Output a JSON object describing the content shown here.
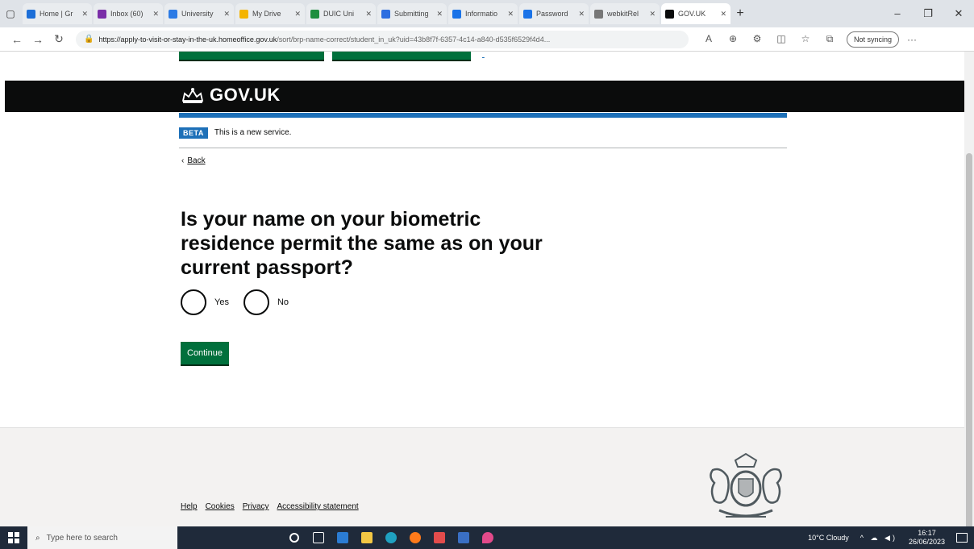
{
  "browser": {
    "tabs": [
      {
        "label": "Home | Gr",
        "color": "#1d6fd8"
      },
      {
        "label": "Inbox (60)",
        "color": "#7a2ea8"
      },
      {
        "label": "University",
        "color": "#2c7be5"
      },
      {
        "label": "My Drive",
        "color": "#f4b400"
      },
      {
        "label": "DUIC Uni",
        "color": "#1e8e3e"
      },
      {
        "label": "Submitting",
        "color": "#2d6ee0"
      },
      {
        "label": "Informatio",
        "color": "#1a73e8"
      },
      {
        "label": "Password",
        "color": "#1a73e8"
      },
      {
        "label": "webkitRel",
        "color": "#777777"
      },
      {
        "label": "GOV.UK",
        "color": "#0b0c0c",
        "active": true
      }
    ],
    "url_host": "https://apply-to-visit-or-stay-in-the-uk.homeoffice.gov.uk",
    "url_path": "/sort/brp-name-correct/student_in_uk?uid=43b8f7f-6357-4c14-a840-d535f6529f4d4...",
    "sync_label": "Not syncing"
  },
  "page": {
    "header_logo": "GOV.UK",
    "phase_tag": "BETA",
    "phase_text": "This is a new service.",
    "back_link": "Back",
    "question": "Is your name on your biometric residence permit the same as on your current passport?",
    "options": [
      "Yes",
      "No"
    ],
    "continue_label": "Continue",
    "footer_links": [
      "Help",
      "Cookies",
      "Privacy",
      "Accessibility statement"
    ]
  },
  "taskbar": {
    "search_placeholder": "Type here to search",
    "weather": "10°C Cloudy",
    "time": "16:17",
    "date": "26/06/2023"
  }
}
